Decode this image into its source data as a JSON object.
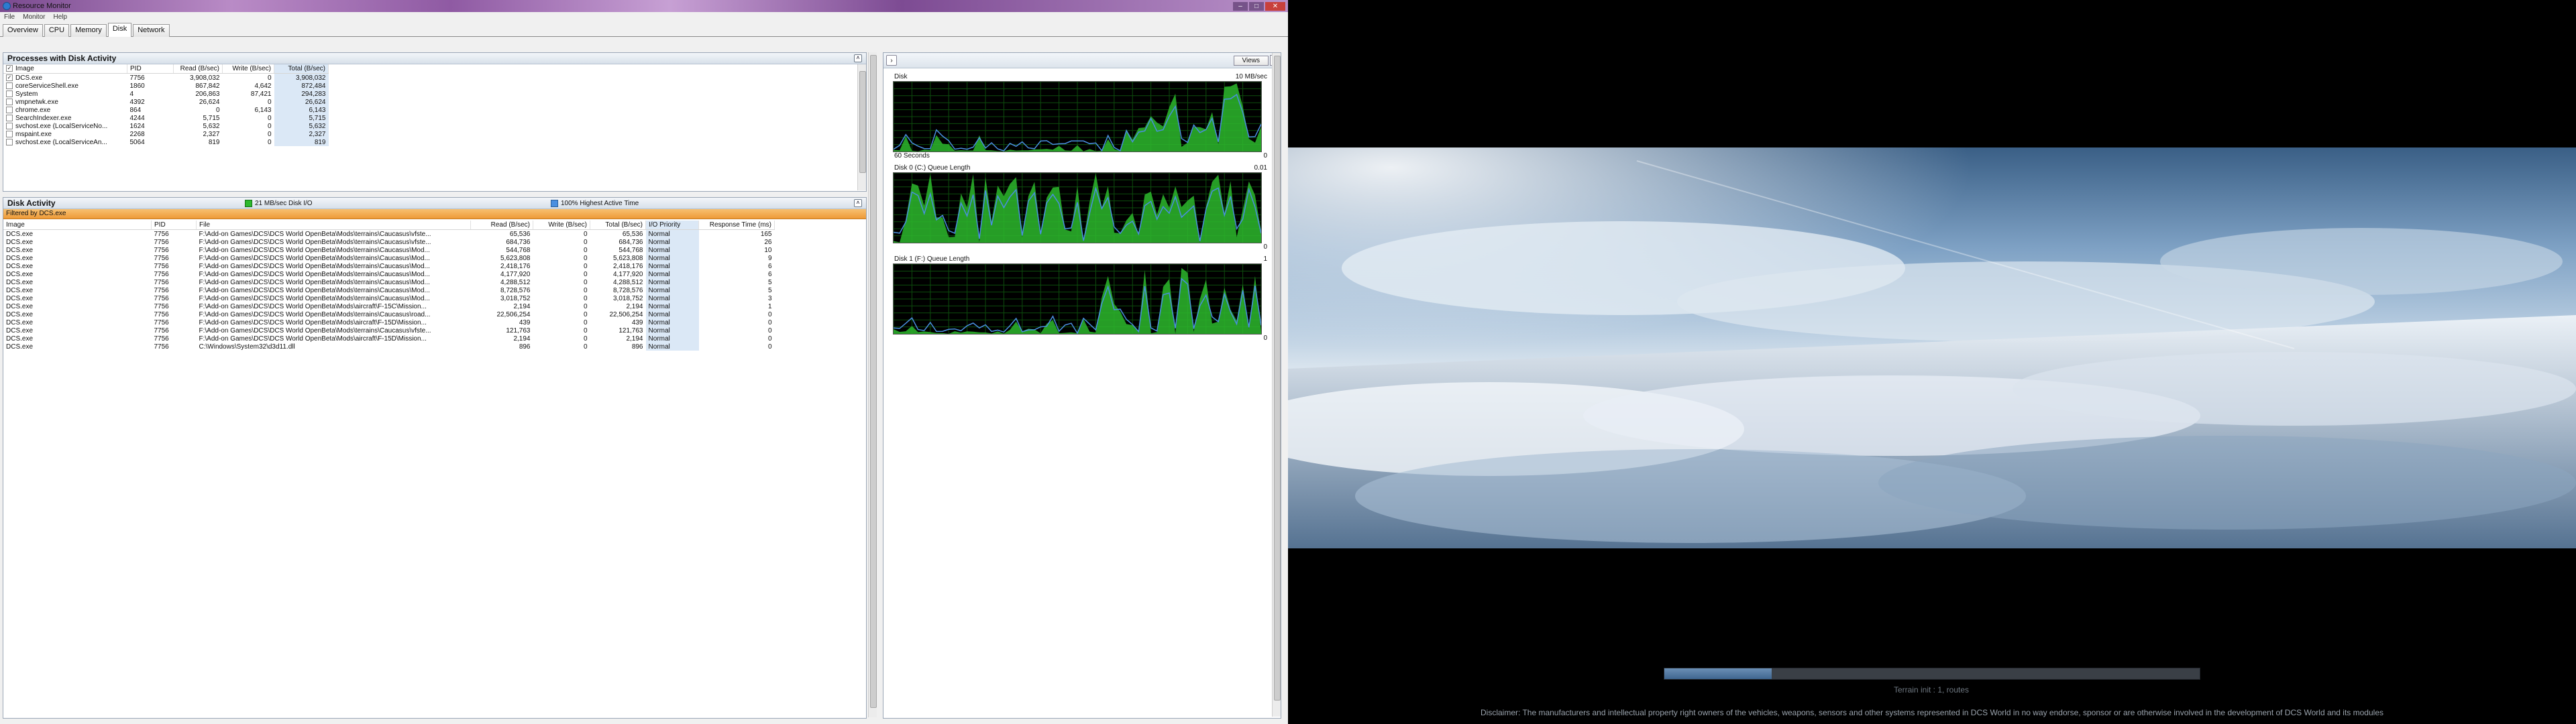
{
  "window": {
    "title": "Resource Monitor",
    "menu": [
      "File",
      "Monitor",
      "Help"
    ]
  },
  "tabs": [
    "Overview",
    "CPU",
    "Memory",
    "Disk",
    "Network"
  ],
  "active_tab": "Disk",
  "processes": {
    "title": "Processes with Disk Activity",
    "columns": [
      "Image",
      "PID",
      "Read (B/sec)",
      "Write (B/sec)",
      "Total (B/sec)"
    ],
    "rows": [
      {
        "checked": true,
        "image": "DCS.exe",
        "pid": "7756",
        "read": "3,908,032",
        "write": "0",
        "total": "3,908,032"
      },
      {
        "checked": false,
        "image": "coreServiceShell.exe",
        "pid": "1860",
        "read": "867,842",
        "write": "4,642",
        "total": "872,484"
      },
      {
        "checked": false,
        "image": "System",
        "pid": "4",
        "read": "206,863",
        "write": "87,421",
        "total": "294,283"
      },
      {
        "checked": false,
        "image": "vmpnetwk.exe",
        "pid": "4392",
        "read": "26,624",
        "write": "0",
        "total": "26,624"
      },
      {
        "checked": false,
        "image": "chrome.exe",
        "pid": "864",
        "read": "0",
        "write": "6,143",
        "total": "6,143"
      },
      {
        "checked": false,
        "image": "SearchIndexer.exe",
        "pid": "4244",
        "read": "5,715",
        "write": "0",
        "total": "5,715"
      },
      {
        "checked": false,
        "image": "svchost.exe (LocalServiceNo...",
        "pid": "1624",
        "read": "5,632",
        "write": "0",
        "total": "5,632"
      },
      {
        "checked": false,
        "image": "mspaint.exe",
        "pid": "2268",
        "read": "2,327",
        "write": "0",
        "total": "2,327"
      },
      {
        "checked": false,
        "image": "svchost.exe (LocalServiceAn...",
        "pid": "5064",
        "read": "819",
        "write": "0",
        "total": "819"
      }
    ]
  },
  "disk_activity": {
    "title": "Disk Activity",
    "legend_io": "21 MB/sec Disk I/O",
    "legend_active": "100% Highest Active Time",
    "filter": "Filtered by DCS.exe",
    "columns": [
      "Image",
      "PID",
      "File",
      "Read (B/sec)",
      "Write (B/sec)",
      "Total (B/sec)",
      "I/O Priority",
      "Response Time (ms)"
    ],
    "rows": [
      {
        "image": "DCS.exe",
        "pid": "7756",
        "file": "F:\\Add-on Games\\DCS\\DCS World OpenBeta\\Mods\\terrains\\Caucasus\\vfste...",
        "read": "65,536",
        "write": "0",
        "total": "65,536",
        "priority": "Normal",
        "resp": "165"
      },
      {
        "image": "DCS.exe",
        "pid": "7756",
        "file": "F:\\Add-on Games\\DCS\\DCS World OpenBeta\\Mods\\terrains\\Caucasus\\vfste...",
        "read": "684,736",
        "write": "0",
        "total": "684,736",
        "priority": "Normal",
        "resp": "26"
      },
      {
        "image": "DCS.exe",
        "pid": "7756",
        "file": "F:\\Add-on Games\\DCS\\DCS World OpenBeta\\Mods\\terrains\\Caucasus\\Mod...",
        "read": "544,768",
        "write": "0",
        "total": "544,768",
        "priority": "Normal",
        "resp": "10"
      },
      {
        "image": "DCS.exe",
        "pid": "7756",
        "file": "F:\\Add-on Games\\DCS\\DCS World OpenBeta\\Mods\\terrains\\Caucasus\\Mod...",
        "read": "5,623,808",
        "write": "0",
        "total": "5,623,808",
        "priority": "Normal",
        "resp": "9"
      },
      {
        "image": "DCS.exe",
        "pid": "7756",
        "file": "F:\\Add-on Games\\DCS\\DCS World OpenBeta\\Mods\\terrains\\Caucasus\\Mod...",
        "read": "2,418,176",
        "write": "0",
        "total": "2,418,176",
        "priority": "Normal",
        "resp": "6"
      },
      {
        "image": "DCS.exe",
        "pid": "7756",
        "file": "F:\\Add-on Games\\DCS\\DCS World OpenBeta\\Mods\\terrains\\Caucasus\\Mod...",
        "read": "4,177,920",
        "write": "0",
        "total": "4,177,920",
        "priority": "Normal",
        "resp": "6"
      },
      {
        "image": "DCS.exe",
        "pid": "7756",
        "file": "F:\\Add-on Games\\DCS\\DCS World OpenBeta\\Mods\\terrains\\Caucasus\\Mod...",
        "read": "4,288,512",
        "write": "0",
        "total": "4,288,512",
        "priority": "Normal",
        "resp": "5"
      },
      {
        "image": "DCS.exe",
        "pid": "7756",
        "file": "F:\\Add-on Games\\DCS\\DCS World OpenBeta\\Mods\\terrains\\Caucasus\\Mod...",
        "read": "8,728,576",
        "write": "0",
        "total": "8,728,576",
        "priority": "Normal",
        "resp": "5"
      },
      {
        "image": "DCS.exe",
        "pid": "7756",
        "file": "F:\\Add-on Games\\DCS\\DCS World OpenBeta\\Mods\\terrains\\Caucasus\\Mod...",
        "read": "3,018,752",
        "write": "0",
        "total": "3,018,752",
        "priority": "Normal",
        "resp": "3"
      },
      {
        "image": "DCS.exe",
        "pid": "7756",
        "file": "F:\\Add-on Games\\DCS\\DCS World OpenBeta\\Mods\\aircraft\\F-15C\\Mission...",
        "read": "2,194",
        "write": "0",
        "total": "2,194",
        "priority": "Normal",
        "resp": "1"
      },
      {
        "image": "DCS.exe",
        "pid": "7756",
        "file": "F:\\Add-on Games\\DCS\\DCS World OpenBeta\\Mods\\terrains\\Caucasus\\road...",
        "read": "22,506,254",
        "write": "0",
        "total": "22,506,254",
        "priority": "Normal",
        "resp": "0"
      },
      {
        "image": "DCS.exe",
        "pid": "7756",
        "file": "F:\\Add-on Games\\DCS\\DCS World OpenBeta\\Mods\\aircraft\\F-15D\\Mission...",
        "read": "439",
        "write": "0",
        "total": "439",
        "priority": "Normal",
        "resp": "0"
      },
      {
        "image": "DCS.exe",
        "pid": "7756",
        "file": "F:\\Add-on Games\\DCS\\DCS World OpenBeta\\Mods\\terrains\\Caucasus\\vfste...",
        "read": "121,763",
        "write": "0",
        "total": "121,763",
        "priority": "Normal",
        "resp": "0"
      },
      {
        "image": "DCS.exe",
        "pid": "7756",
        "file": "F:\\Add-on Games\\DCS\\DCS World OpenBeta\\Mods\\aircraft\\F-15D\\Mission...",
        "read": "2,194",
        "write": "0",
        "total": "2,194",
        "priority": "Normal",
        "resp": "0"
      },
      {
        "image": "DCS.exe",
        "pid": "7756",
        "file": "C:\\Windows\\System32\\d3d11.dll",
        "read": "896",
        "write": "0",
        "total": "896",
        "priority": "Normal",
        "resp": "0"
      }
    ]
  },
  "graphs": {
    "views_label": "Views",
    "disk": {
      "label": "Disk",
      "max": "10 MB/sec",
      "x_label": "60 Seconds",
      "min": "0"
    },
    "disk0": {
      "label": "Disk 0 (C:) Queue Length",
      "max": "0.01",
      "min": "0"
    },
    "disk1": {
      "label": "Disk 1 (F:) Queue Length",
      "max": "1",
      "min": "0"
    }
  },
  "dcs": {
    "progress_fraction": 0.2,
    "progress_label": "Terrain init : 1, routes",
    "disclaimer": "Disclaimer: The manufacturers and intellectual property right owners of the vehicles, weapons, sensors and other systems represented in DCS World in no way endorse, sponsor or are otherwise involved in the development of DCS World and its modules"
  },
  "colors": {
    "graph_green": "#2db92d",
    "graph_blue": "#4a8fe0",
    "accent_orange": "#f0a040"
  }
}
